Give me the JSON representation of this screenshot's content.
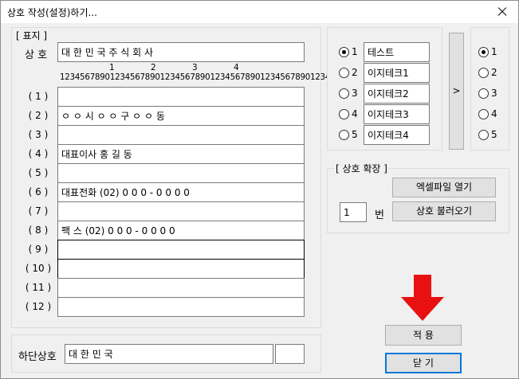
{
  "window": {
    "title": "상호 작성(설정)하기..."
  },
  "pyoji": {
    "group_label": "[ 표지 ]",
    "sangho_label": "상 호",
    "sangho_value": "대 한 민 국 주 식 회 사",
    "ruler_tens": [
      "1",
      "2",
      "3",
      "4"
    ],
    "ruler_digits": "123456789012345678901234567890123456789012345678901234567890123",
    "rows": [
      {
        "label": "( 1 )",
        "value": ""
      },
      {
        "label": "( 2 )",
        "value": "ㅇ ㅇ 시 ㅇ  ㅇ  구 ㅇ  ㅇ  동"
      },
      {
        "label": "( 3 )",
        "value": ""
      },
      {
        "label": "( 4 )",
        "value": "대표이사    홍      길      동"
      },
      {
        "label": "( 5 )",
        "value": ""
      },
      {
        "label": "( 6 )",
        "value": "대표전화   (02) 0 0 0 - 0 0 0 0"
      },
      {
        "label": "( 7 )",
        "value": ""
      },
      {
        "label": "( 8 )",
        "value": "팩      스    (02) 0 0 0 - 0 0 0 0"
      },
      {
        "label": "( 9 )",
        "value": ""
      },
      {
        "label": "( 10 )",
        "value": ""
      },
      {
        "label": "( 11 )",
        "value": ""
      },
      {
        "label": "( 12 )",
        "value": ""
      }
    ]
  },
  "bottom": {
    "label": "하단상호",
    "value": "대 한 민 국",
    "extra": ""
  },
  "left_radios": [
    {
      "num": "1",
      "value": "테스트",
      "checked": true
    },
    {
      "num": "2",
      "value": "이지테크1",
      "checked": false
    },
    {
      "num": "3",
      "value": "이지테크2",
      "checked": false
    },
    {
      "num": "4",
      "value": "이지테크3",
      "checked": false
    },
    {
      "num": "5",
      "value": "이지테크4",
      "checked": false
    }
  ],
  "arrow_button": ">",
  "right_radios": [
    {
      "num": "1",
      "checked": true
    },
    {
      "num": "2",
      "checked": false
    },
    {
      "num": "3",
      "checked": false
    },
    {
      "num": "4",
      "checked": false
    },
    {
      "num": "5",
      "checked": false
    }
  ],
  "expand": {
    "group_label": "[ 상호 확장 ]",
    "excel_button": "엑셀파일 열기",
    "number_value": "1",
    "number_unit": "번",
    "load_button": "상호 불러오기"
  },
  "apply_button": "적 용",
  "close_button": "닫 기",
  "annotation_color": "#e81010"
}
